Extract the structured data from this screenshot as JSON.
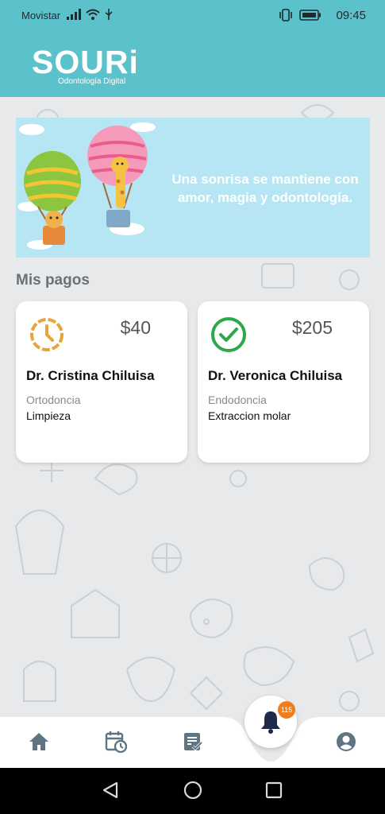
{
  "status_bar": {
    "carrier": "Movistar",
    "time": "09:45",
    "icons": [
      "signal-icon",
      "wifi-icon",
      "usb-icon",
      "vibrate-icon",
      "battery-icon"
    ]
  },
  "header": {
    "logo_word": "SOURi",
    "logo_subtitle": "Odontología Digital"
  },
  "banner": {
    "text": "Una sonrisa se mantiene con amor, magia y odontología."
  },
  "section": {
    "title": "Mis pagos"
  },
  "payments": [
    {
      "status": "pending",
      "status_icon": "clock-icon",
      "amount": "$40",
      "doctor": "Dr. Cristina Chiluisa",
      "specialty": "Ortodoncia",
      "treatment": "Limpieza"
    },
    {
      "status": "paid",
      "status_icon": "check-circle-icon",
      "amount": "$205",
      "doctor": "Dr. Veronica Chiluisa",
      "specialty": "Endodoncia",
      "treatment": "Extraccion molar"
    }
  ],
  "bottom_nav": {
    "items": [
      "home-icon",
      "calendar-clock-icon",
      "list-check-icon",
      "bell-icon",
      "account-icon"
    ],
    "notification_count": "115"
  },
  "colors": {
    "brand": "#5bc2cb",
    "pending": "#e8a33d",
    "paid": "#2aa84a",
    "badge": "#f07d1c",
    "nav_icon": "#5f7582"
  }
}
